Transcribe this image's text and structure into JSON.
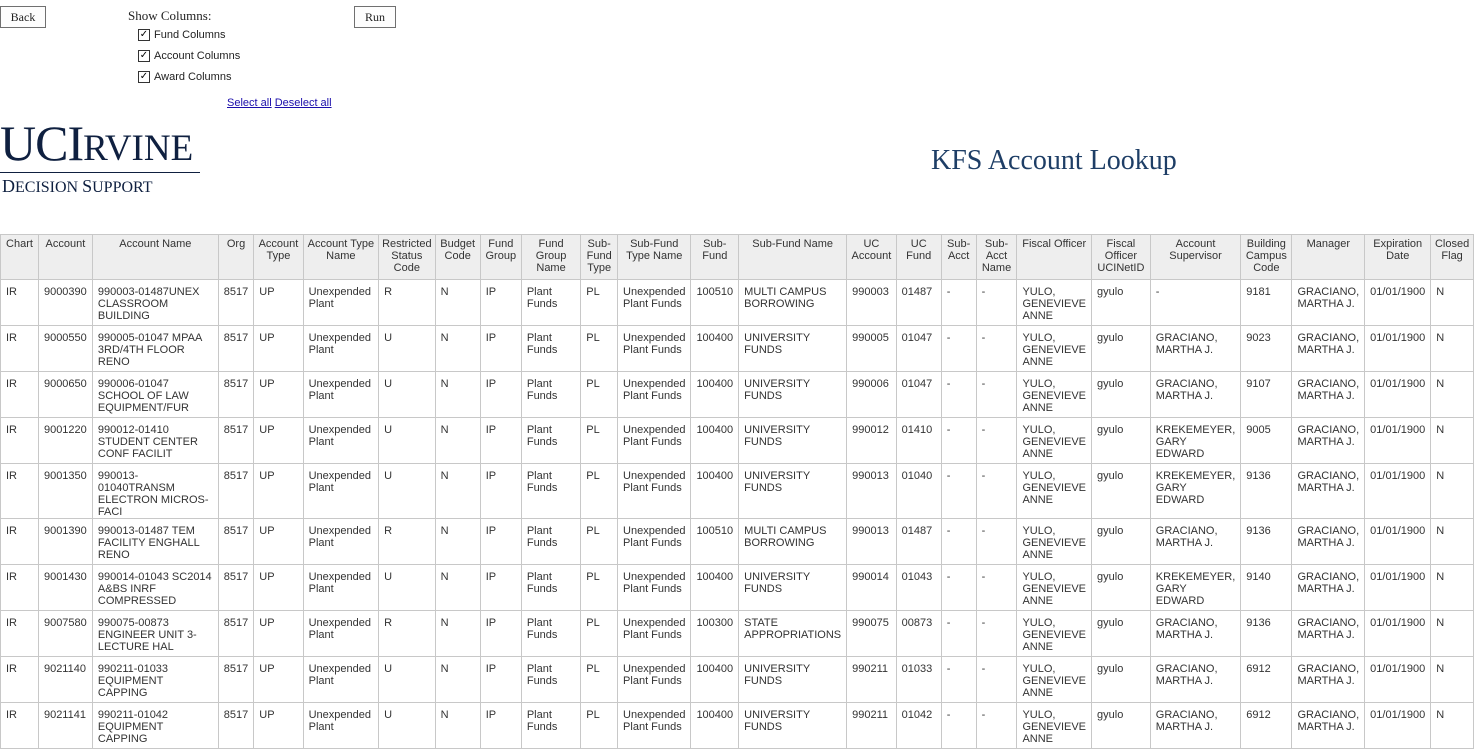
{
  "toolbar": {
    "back_label": "Back",
    "run_label": "Run",
    "show_columns_label": "Show Columns:",
    "column_toggles": [
      {
        "label": "Fund Columns",
        "checked": true
      },
      {
        "label": "Account Columns",
        "checked": true
      },
      {
        "label": "Award Columns",
        "checked": true
      }
    ],
    "select_all": "Select all",
    "deselect_all": "Deselect all"
  },
  "logo": {
    "uc": "UC",
    "i": "I",
    "rvine": "RVINE",
    "d": "D",
    "ecision": "ECISION ",
    "s": "S",
    "upport": "UPPORT"
  },
  "page_title": "KFS Account Lookup",
  "table": {
    "headers": [
      "Chart",
      "Account",
      "Account Name",
      "Org",
      "Account Type",
      "Account Type Name",
      "Restricted Status Code",
      "Budget Code",
      "Fund Group",
      "Fund Group Name",
      "Sub-Fund Type",
      "Sub-Fund Type Name",
      "Sub-Fund",
      "Sub-Fund Name",
      "UC Account",
      "UC Fund",
      "Sub-Acct",
      "Sub-Acct Name",
      "Fiscal Officer",
      "Fiscal Officer UCINetID",
      "Account Supervisor",
      "Building Campus Code",
      "Manager",
      "Expiration Date",
      "Closed Flag"
    ],
    "rows": [
      [
        "IR",
        "9000390",
        "990003-01487UNEX CLASSROOM BUILDING",
        "8517",
        "UP",
        "Unexpended Plant",
        "R",
        "N",
        "IP",
        "Plant Funds",
        "PL",
        "Unexpended Plant Funds",
        "100510",
        "MULTI CAMPUS BORROWING",
        "990003",
        "01487",
        "-",
        "-",
        "YULO, GENEVIEVE ANNE",
        "gyulo",
        "-",
        "9181",
        "GRACIANO, MARTHA J.",
        "01/01/1900",
        "N"
      ],
      [
        "IR",
        "9000550",
        "990005-01047 MPAA 3RD/4TH FLOOR RENO",
        "8517",
        "UP",
        "Unexpended Plant",
        "U",
        "N",
        "IP",
        "Plant Funds",
        "PL",
        "Unexpended Plant Funds",
        "100400",
        "UNIVERSITY FUNDS",
        "990005",
        "01047",
        "-",
        "-",
        "YULO, GENEVIEVE ANNE",
        "gyulo",
        "GRACIANO, MARTHA J.",
        "9023",
        "GRACIANO, MARTHA J.",
        "01/01/1900",
        "N"
      ],
      [
        "IR",
        "9000650",
        "990006-01047 SCHOOL OF LAW EQUIPMENT/FUR",
        "8517",
        "UP",
        "Unexpended Plant",
        "U",
        "N",
        "IP",
        "Plant Funds",
        "PL",
        "Unexpended Plant Funds",
        "100400",
        "UNIVERSITY FUNDS",
        "990006",
        "01047",
        "-",
        "-",
        "YULO, GENEVIEVE ANNE",
        "gyulo",
        "GRACIANO, MARTHA J.",
        "9107",
        "GRACIANO, MARTHA J.",
        "01/01/1900",
        "N"
      ],
      [
        "IR",
        "9001220",
        "990012-01410 STUDENT CENTER CONF FACILIT",
        "8517",
        "UP",
        "Unexpended Plant",
        "U",
        "N",
        "IP",
        "Plant Funds",
        "PL",
        "Unexpended Plant Funds",
        "100400",
        "UNIVERSITY FUNDS",
        "990012",
        "01410",
        "-",
        "-",
        "YULO, GENEVIEVE ANNE",
        "gyulo",
        "KREKEMEYER, GARY EDWARD",
        "9005",
        "GRACIANO, MARTHA J.",
        "01/01/1900",
        "N"
      ],
      [
        "IR",
        "9001350",
        "990013-01040TRANSM ELECTRON MICROS-FACI",
        "8517",
        "UP",
        "Unexpended Plant",
        "U",
        "N",
        "IP",
        "Plant Funds",
        "PL",
        "Unexpended Plant Funds",
        "100400",
        "UNIVERSITY FUNDS",
        "990013",
        "01040",
        "-",
        "-",
        "YULO, GENEVIEVE ANNE",
        "gyulo",
        "KREKEMEYER, GARY EDWARD",
        "9136",
        "GRACIANO, MARTHA J.",
        "01/01/1900",
        "N"
      ],
      [
        "IR",
        "9001390",
        "990013-01487 TEM FACILITY ENGHALL RENO",
        "8517",
        "UP",
        "Unexpended Plant",
        "R",
        "N",
        "IP",
        "Plant Funds",
        "PL",
        "Unexpended Plant Funds",
        "100510",
        "MULTI CAMPUS BORROWING",
        "990013",
        "01487",
        "-",
        "-",
        "YULO, GENEVIEVE ANNE",
        "gyulo",
        "GRACIANO, MARTHA J.",
        "9136",
        "GRACIANO, MARTHA J.",
        "01/01/1900",
        "N"
      ],
      [
        "IR",
        "9001430",
        "990014-01043 SC2014 A&BS INRF COMPRESSED",
        "8517",
        "UP",
        "Unexpended Plant",
        "U",
        "N",
        "IP",
        "Plant Funds",
        "PL",
        "Unexpended Plant Funds",
        "100400",
        "UNIVERSITY FUNDS",
        "990014",
        "01043",
        "-",
        "-",
        "YULO, GENEVIEVE ANNE",
        "gyulo",
        "KREKEMEYER, GARY EDWARD",
        "9140",
        "GRACIANO, MARTHA J.",
        "01/01/1900",
        "N"
      ],
      [
        "IR",
        "9007580",
        "990075-00873 ENGINEER UNIT 3-LECTURE HAL",
        "8517",
        "UP",
        "Unexpended Plant",
        "R",
        "N",
        "IP",
        "Plant Funds",
        "PL",
        "Unexpended Plant Funds",
        "100300",
        "STATE APPROPRIATIONS",
        "990075",
        "00873",
        "-",
        "-",
        "YULO, GENEVIEVE ANNE",
        "gyulo",
        "GRACIANO, MARTHA J.",
        "9136",
        "GRACIANO, MARTHA J.",
        "01/01/1900",
        "N"
      ],
      [
        "IR",
        "9021140",
        "990211-01033 EQUIPMENT CAPPING",
        "8517",
        "UP",
        "Unexpended Plant",
        "U",
        "N",
        "IP",
        "Plant Funds",
        "PL",
        "Unexpended Plant Funds",
        "100400",
        "UNIVERSITY FUNDS",
        "990211",
        "01033",
        "-",
        "-",
        "YULO, GENEVIEVE ANNE",
        "gyulo",
        "GRACIANO, MARTHA J.",
        "6912",
        "GRACIANO, MARTHA J.",
        "01/01/1900",
        "N"
      ],
      [
        "IR",
        "9021141",
        "990211-01042 EQUIPMENT CAPPING",
        "8517",
        "UP",
        "Unexpended Plant",
        "U",
        "N",
        "IP",
        "Plant Funds",
        "PL",
        "Unexpended Plant Funds",
        "100400",
        "UNIVERSITY FUNDS",
        "990211",
        "01042",
        "-",
        "-",
        "YULO, GENEVIEVE ANNE",
        "gyulo",
        "GRACIANO, MARTHA J.",
        "6912",
        "GRACIANO, MARTHA J.",
        "01/01/1900",
        "N"
      ]
    ]
  }
}
